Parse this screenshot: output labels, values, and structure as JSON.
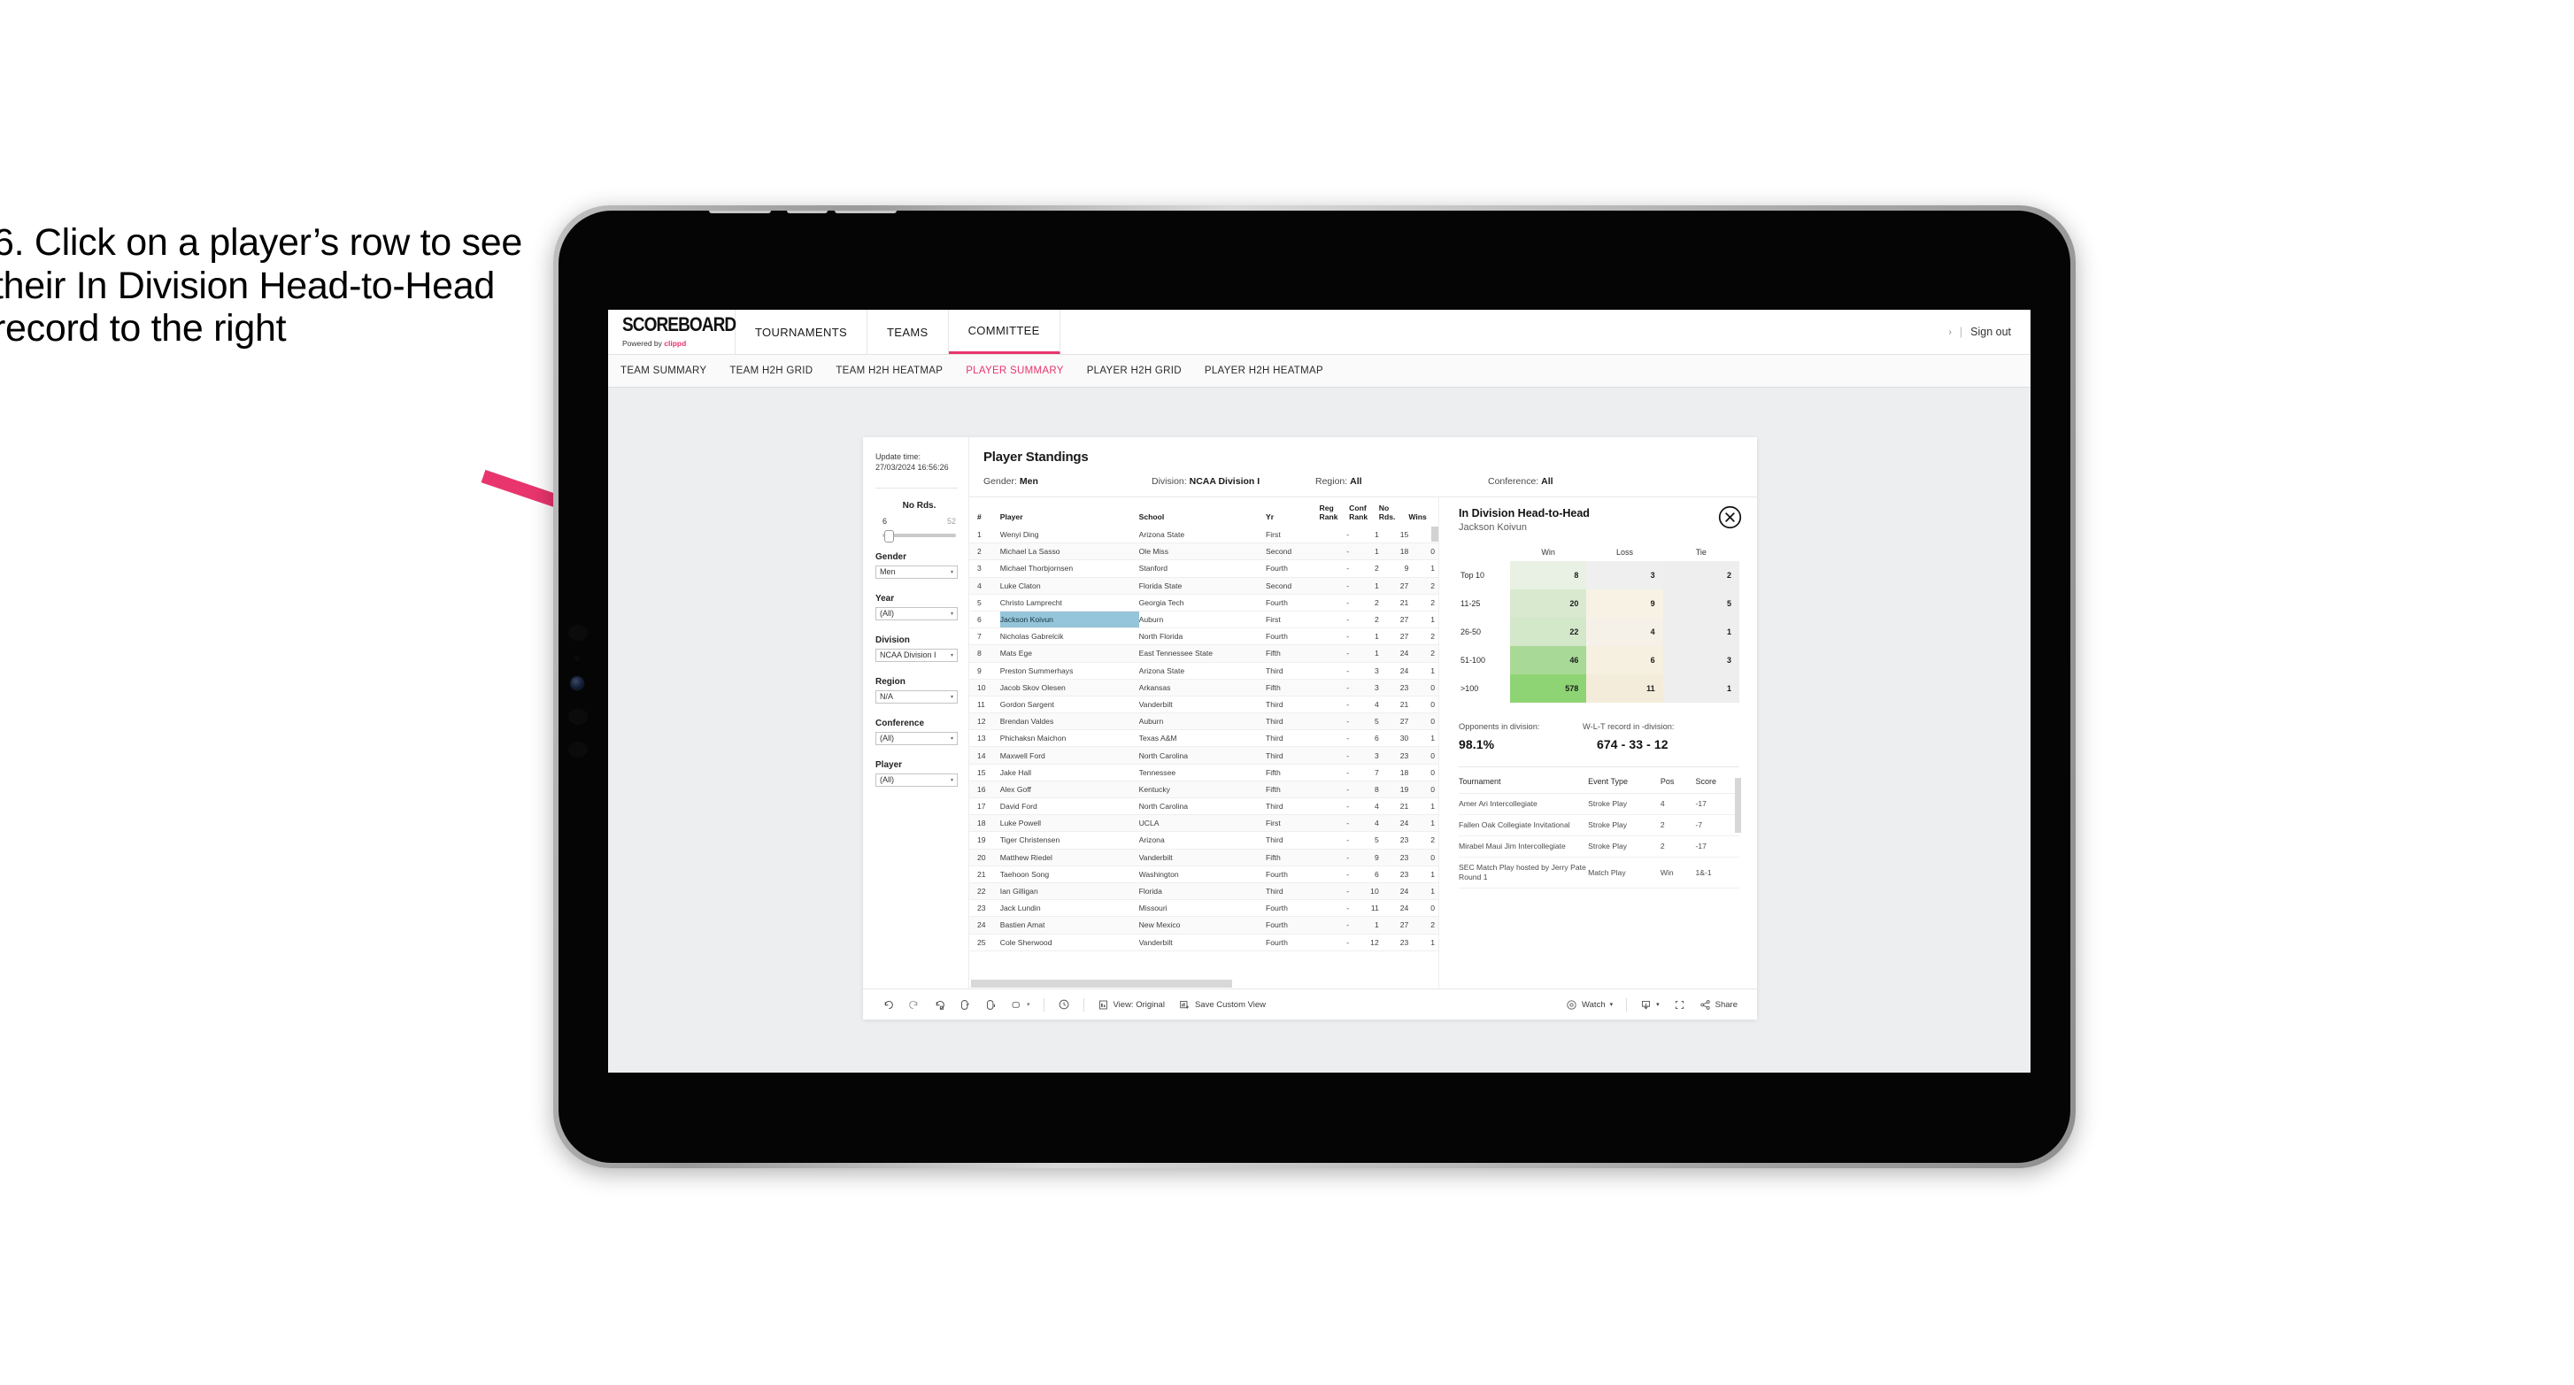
{
  "instruction": {
    "text": "6. Click on a player’s row to see their In Division Head-to-Head record to the right"
  },
  "colors": {
    "accent": "#e8356d",
    "arrow": "#e8356d",
    "selected_row": "#95c5da",
    "win_low": "#e9f1e5",
    "win_high": "#8ed474",
    "loss_tint": "#f6f1e4",
    "tie_tint": "#eeeeee"
  },
  "appbar": {
    "logo_main": "SCOREBOARD",
    "logo_sub_prefix": "Powered by ",
    "logo_sub_brand": "clippd",
    "nav": [
      {
        "label": "TOURNAMENTS",
        "active": false
      },
      {
        "label": "TEAMS",
        "active": false
      },
      {
        "label": "COMMITTEE",
        "active": true
      }
    ],
    "sign_out": "Sign out",
    "sign_out_sep": "|",
    "sign_out_chevron": "›"
  },
  "subnav": {
    "items": [
      {
        "label": "TEAM SUMMARY",
        "active": false
      },
      {
        "label": "TEAM H2H GRID",
        "active": false
      },
      {
        "label": "TEAM H2H HEATMAP",
        "active": false
      },
      {
        "label": "PLAYER SUMMARY",
        "active": true
      },
      {
        "label": "PLAYER H2H GRID",
        "active": false
      },
      {
        "label": "PLAYER H2H HEATMAP",
        "active": false
      }
    ]
  },
  "filters": {
    "update_time_label": "Update time:",
    "update_time_value": "27/03/2024 16:56:26",
    "slider": {
      "title": "No Rds.",
      "min": "6",
      "max": "52"
    },
    "groups": [
      {
        "label": "Gender",
        "value": "Men"
      },
      {
        "label": "Year",
        "value": "(All)"
      },
      {
        "label": "Division",
        "value": "NCAA Division I"
      },
      {
        "label": "Region",
        "value": "N/A"
      },
      {
        "label": "Conference",
        "value": "(All)"
      },
      {
        "label": "Player",
        "value": "(All)"
      }
    ],
    "caret": "▾"
  },
  "standings": {
    "title": "Player Standings",
    "summary": [
      {
        "label": "Gender: ",
        "value": "Men"
      },
      {
        "label": "Division: ",
        "value": "NCAA Division I"
      },
      {
        "label": "Region: ",
        "value": "All"
      },
      {
        "label": "Conference: ",
        "value": "All"
      }
    ],
    "columns": [
      "#",
      "Player",
      "School",
      "Yr",
      "Reg Rank",
      "Conf Rank",
      "No Rds.",
      "Wins"
    ],
    "rows": [
      {
        "no": "1",
        "player": "Wenyi Ding",
        "school": "Arizona State",
        "yr": "First",
        "reg": "-",
        "conf": "1",
        "rds": "15",
        "wins": "1",
        "selected": false
      },
      {
        "no": "2",
        "player": "Michael La Sasso",
        "school": "Ole Miss",
        "yr": "Second",
        "reg": "-",
        "conf": "1",
        "rds": "18",
        "wins": "0",
        "selected": false
      },
      {
        "no": "3",
        "player": "Michael Thorbjornsen",
        "school": "Stanford",
        "yr": "Fourth",
        "reg": "-",
        "conf": "2",
        "rds": "9",
        "wins": "1",
        "selected": false
      },
      {
        "no": "4",
        "player": "Luke Claton",
        "school": "Florida State",
        "yr": "Second",
        "reg": "-",
        "conf": "1",
        "rds": "27",
        "wins": "2",
        "selected": false
      },
      {
        "no": "5",
        "player": "Christo Lamprecht",
        "school": "Georgia Tech",
        "yr": "Fourth",
        "reg": "-",
        "conf": "2",
        "rds": "21",
        "wins": "2",
        "selected": false
      },
      {
        "no": "6",
        "player": "Jackson Koivun",
        "school": "Auburn",
        "yr": "First",
        "reg": "-",
        "conf": "2",
        "rds": "27",
        "wins": "1",
        "selected": true
      },
      {
        "no": "7",
        "player": "Nicholas Gabrelcik",
        "school": "North Florida",
        "yr": "Fourth",
        "reg": "-",
        "conf": "1",
        "rds": "27",
        "wins": "2",
        "selected": false
      },
      {
        "no": "8",
        "player": "Mats Ege",
        "school": "East Tennessee State",
        "yr": "Fifth",
        "reg": "-",
        "conf": "1",
        "rds": "24",
        "wins": "2",
        "selected": false
      },
      {
        "no": "9",
        "player": "Preston Summerhays",
        "school": "Arizona State",
        "yr": "Third",
        "reg": "-",
        "conf": "3",
        "rds": "24",
        "wins": "1",
        "selected": false
      },
      {
        "no": "10",
        "player": "Jacob Skov Olesen",
        "school": "Arkansas",
        "yr": "Fifth",
        "reg": "-",
        "conf": "3",
        "rds": "23",
        "wins": "0",
        "selected": false
      },
      {
        "no": "11",
        "player": "Gordon Sargent",
        "school": "Vanderbilt",
        "yr": "Third",
        "reg": "-",
        "conf": "4",
        "rds": "21",
        "wins": "0",
        "selected": false
      },
      {
        "no": "12",
        "player": "Brendan Valdes",
        "school": "Auburn",
        "yr": "Third",
        "reg": "-",
        "conf": "5",
        "rds": "27",
        "wins": "0",
        "selected": false
      },
      {
        "no": "13",
        "player": "Phichaksn Maichon",
        "school": "Texas A&M",
        "yr": "Third",
        "reg": "-",
        "conf": "6",
        "rds": "30",
        "wins": "1",
        "selected": false
      },
      {
        "no": "14",
        "player": "Maxwell Ford",
        "school": "North Carolina",
        "yr": "Third",
        "reg": "-",
        "conf": "3",
        "rds": "23",
        "wins": "0",
        "selected": false
      },
      {
        "no": "15",
        "player": "Jake Hall",
        "school": "Tennessee",
        "yr": "Fifth",
        "reg": "-",
        "conf": "7",
        "rds": "18",
        "wins": "0",
        "selected": false
      },
      {
        "no": "16",
        "player": "Alex Goff",
        "school": "Kentucky",
        "yr": "Fifth",
        "reg": "-",
        "conf": "8",
        "rds": "19",
        "wins": "0",
        "selected": false
      },
      {
        "no": "17",
        "player": "David Ford",
        "school": "North Carolina",
        "yr": "Third",
        "reg": "-",
        "conf": "4",
        "rds": "21",
        "wins": "1",
        "selected": false
      },
      {
        "no": "18",
        "player": "Luke Powell",
        "school": "UCLA",
        "yr": "First",
        "reg": "-",
        "conf": "4",
        "rds": "24",
        "wins": "1",
        "selected": false
      },
      {
        "no": "19",
        "player": "Tiger Christensen",
        "school": "Arizona",
        "yr": "Third",
        "reg": "-",
        "conf": "5",
        "rds": "23",
        "wins": "2",
        "selected": false
      },
      {
        "no": "20",
        "player": "Matthew Riedel",
        "school": "Vanderbilt",
        "yr": "Fifth",
        "reg": "-",
        "conf": "9",
        "rds": "23",
        "wins": "0",
        "selected": false
      },
      {
        "no": "21",
        "player": "Taehoon Song",
        "school": "Washington",
        "yr": "Fourth",
        "reg": "-",
        "conf": "6",
        "rds": "23",
        "wins": "1",
        "selected": false
      },
      {
        "no": "22",
        "player": "Ian Gilligan",
        "school": "Florida",
        "yr": "Third",
        "reg": "-",
        "conf": "10",
        "rds": "24",
        "wins": "1",
        "selected": false
      },
      {
        "no": "23",
        "player": "Jack Lundin",
        "school": "Missouri",
        "yr": "Fourth",
        "reg": "-",
        "conf": "11",
        "rds": "24",
        "wins": "0",
        "selected": false
      },
      {
        "no": "24",
        "player": "Bastien Amat",
        "school": "New Mexico",
        "yr": "Fourth",
        "reg": "-",
        "conf": "1",
        "rds": "27",
        "wins": "2",
        "selected": false
      },
      {
        "no": "25",
        "player": "Cole Sherwood",
        "school": "Vanderbilt",
        "yr": "Fourth",
        "reg": "-",
        "conf": "12",
        "rds": "23",
        "wins": "1",
        "selected": false
      }
    ]
  },
  "h2h": {
    "title": "In Division Head-to-Head",
    "player": "Jackson Koivun",
    "close_icon": "close-circle-icon",
    "heatmap": {
      "columns": [
        "Win",
        "Loss",
        "Tie"
      ],
      "rows": [
        {
          "label": "Top 10",
          "win": "8",
          "loss": "3",
          "tie": "2",
          "win_shade": "#e9f1e5",
          "loss_shade": "#efefef",
          "tie_shade": "#eeeeee"
        },
        {
          "label": "11-25",
          "win": "20",
          "loss": "9",
          "tie": "5",
          "win_shade": "#d8e9cf",
          "loss_shade": "#f7f2e4",
          "tie_shade": "#eeeeee"
        },
        {
          "label": "26-50",
          "win": "22",
          "loss": "4",
          "tie": "1",
          "win_shade": "#d3e7c9",
          "loss_shade": "#f5f1e8",
          "tie_shade": "#eeeeee"
        },
        {
          "label": "51-100",
          "win": "46",
          "loss": "6",
          "tie": "3",
          "win_shade": "#a9d996",
          "loss_shade": "#f6f0e0",
          "tie_shade": "#eeeeee"
        },
        {
          "label": ">100",
          "win": "578",
          "loss": "11",
          "tie": "1",
          "win_shade": "#8ed474",
          "loss_shade": "#f4ecda",
          "tie_shade": "#eeeeee"
        }
      ]
    },
    "stats": {
      "opponents_label": "Opponents in division:",
      "opponents_value": "98.1%",
      "record_label": "W-L-T record in -division:",
      "record_value": "674 - 33 - 12"
    },
    "tournaments": {
      "columns": [
        "Tournament",
        "Event Type",
        "Pos",
        "Score"
      ],
      "rows": [
        {
          "name": "Amer Ari Intercollegiate",
          "type": "Stroke Play",
          "pos": "4",
          "score": "-17"
        },
        {
          "name": "Fallen Oak Collegiate Invitational",
          "type": "Stroke Play",
          "pos": "2",
          "score": "-7"
        },
        {
          "name": "Mirabel Maui Jim Intercollegiate",
          "type": "Stroke Play",
          "pos": "2",
          "score": "-17"
        },
        {
          "name": "SEC Match Play hosted by Jerry Pate Round 1",
          "type": "Match Play",
          "pos": "Win",
          "score": "1&-1"
        }
      ]
    }
  },
  "toolbar": {
    "view_label": "View: Original",
    "save_label": "Save Custom View",
    "watch_label": "Watch",
    "share_label": "Share",
    "caret": "▾"
  }
}
